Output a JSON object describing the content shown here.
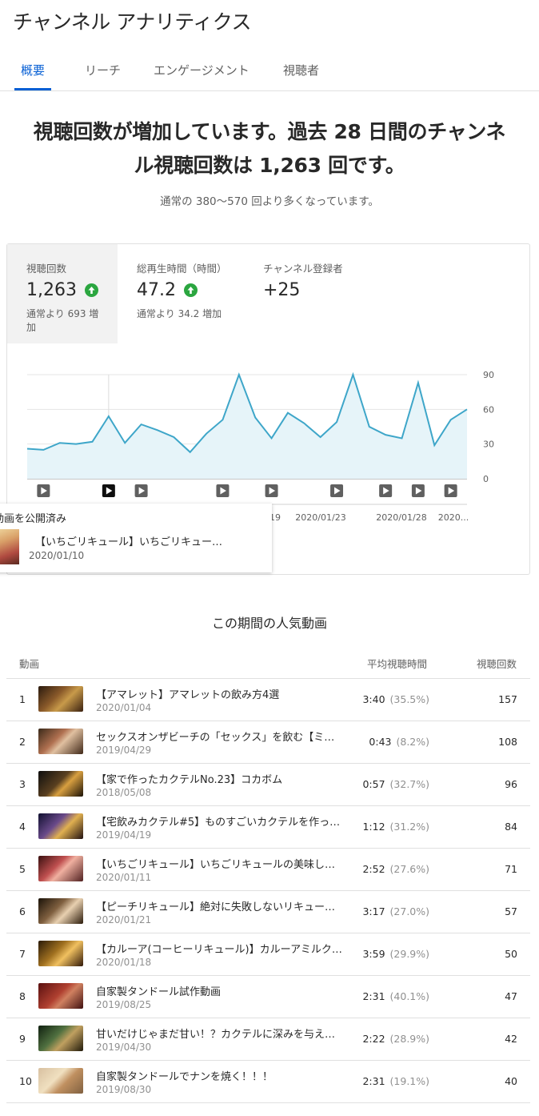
{
  "app": {
    "title": "チャンネル アナリティクス"
  },
  "tabs": [
    {
      "label": "概要",
      "active": true
    },
    {
      "label": "リーチ",
      "active": false
    },
    {
      "label": "エンゲージメント",
      "active": false
    },
    {
      "label": "視聴者",
      "active": false
    }
  ],
  "headline": {
    "line1": "視聴回数が増加しています。過去 28 日間のチャンネ",
    "line2": "ル視聴回数は 1,263 回です。",
    "sub": "通常の 380〜570 回より多くなっています。"
  },
  "metrics": [
    {
      "label": "視聴回数",
      "value": "1,263",
      "up": true,
      "note_line1": "通常より 693 増",
      "note_line2": "加"
    },
    {
      "label": "総再生時間（時間）",
      "value": "47.2",
      "up": true,
      "note_line1": "通常より 34.2 増加",
      "note_line2": ""
    },
    {
      "label": "チャンネル登録者",
      "value": "+25",
      "up": false,
      "note_line1": "",
      "note_line2": ""
    }
  ],
  "chart_data": {
    "type": "area",
    "y_ticks": [
      "90",
      "60",
      "30",
      "0"
    ],
    "ylim": [
      0,
      90
    ],
    "x_labels": [
      "19",
      "2020/01/23",
      "2020/01/28",
      "2020..."
    ],
    "values": [
      26,
      25,
      31,
      30,
      32,
      54,
      31,
      47,
      42,
      36,
      23,
      39,
      51,
      90,
      53,
      35,
      57,
      48,
      36,
      49,
      90,
      45,
      38,
      35,
      83,
      29,
      51,
      60
    ],
    "series_color": "#3ea6c9",
    "fill_color": "#e6f4f9",
    "video_markers": [
      1,
      5,
      7,
      12,
      15,
      19,
      22,
      24,
      26
    ]
  },
  "tooltip": {
    "header": "動画を公開済み",
    "title": "【いちごリキュール】いちごリキュー…",
    "date": "2020/01/10"
  },
  "popular": {
    "title": "この期間の人気動画",
    "headers": {
      "video": "動画",
      "avg": "平均視聴時間",
      "views": "視聴回数"
    },
    "rows": [
      {
        "rank": "1",
        "title": "【アマレット】アマレットの飲み方4選",
        "date": "2020/01/04",
        "avg": "3:40",
        "pct": "(35.5%)",
        "views": "157"
      },
      {
        "rank": "2",
        "title": "セックスオンザビーチの「セックス」を飲む【ミ…",
        "date": "2019/04/29",
        "avg": "0:43",
        "pct": "(8.2%)",
        "views": "108"
      },
      {
        "rank": "3",
        "title": "【家で作ったカクテルNo.23】コカボム",
        "date": "2018/05/08",
        "avg": "0:57",
        "pct": "(32.7%)",
        "views": "96"
      },
      {
        "rank": "4",
        "title": "【宅飲みカクテル#5】ものすごいカクテルを作っ…",
        "date": "2019/04/19",
        "avg": "1:12",
        "pct": "(31.2%)",
        "views": "84"
      },
      {
        "rank": "5",
        "title": "【いちごリキュール】いちごリキュールの美味し…",
        "date": "2020/01/11",
        "avg": "2:52",
        "pct": "(27.6%)",
        "views": "71"
      },
      {
        "rank": "6",
        "title": "【ピーチリキュール】絶対に失敗しないリキュー…",
        "date": "2020/01/21",
        "avg": "3:17",
        "pct": "(27.0%)",
        "views": "57"
      },
      {
        "rank": "7",
        "title": "【カルーア(コーヒーリキュール)】カルーアミルク…",
        "date": "2020/01/18",
        "avg": "3:59",
        "pct": "(29.9%)",
        "views": "50"
      },
      {
        "rank": "8",
        "title": "自家製タンドール試作動画",
        "date": "2019/08/25",
        "avg": "2:31",
        "pct": "(40.1%)",
        "views": "47"
      },
      {
        "rank": "9",
        "title": "甘いだけじゃまだ甘い！？カクテルに深みを与え…",
        "date": "2019/04/30",
        "avg": "2:22",
        "pct": "(28.9%)",
        "views": "42"
      },
      {
        "rank": "10",
        "title": "自家製タンドールでナンを焼く！！！",
        "date": "2019/08/30",
        "avg": "2:31",
        "pct": "(19.1%)",
        "views": "40"
      }
    ]
  }
}
